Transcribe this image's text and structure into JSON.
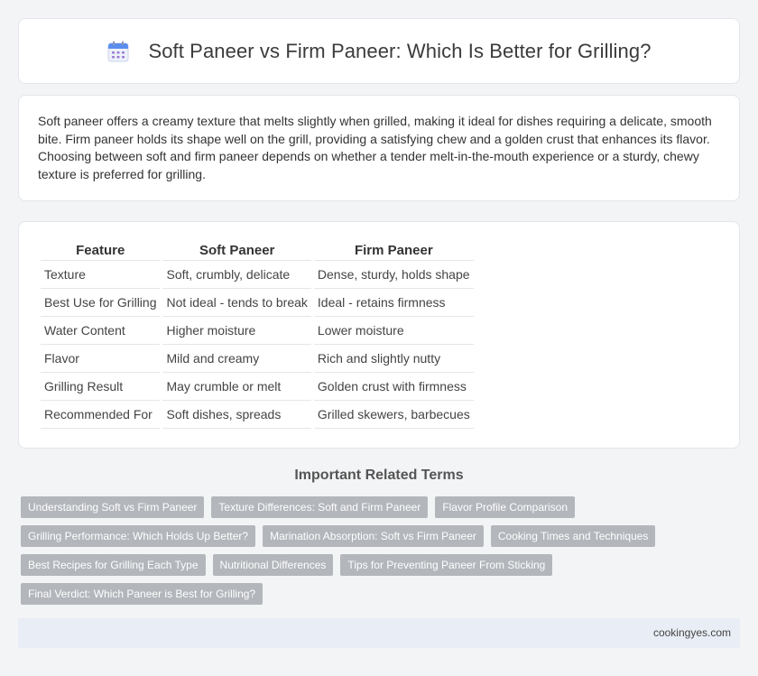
{
  "header": {
    "title": "Soft Paneer vs Firm Paneer: Which Is Better for Grilling?",
    "icon": "calendar-icon"
  },
  "intro": {
    "text": "Soft paneer offers a creamy texture that melts slightly when grilled, making it ideal for dishes requiring a delicate, smooth bite. Firm paneer holds its shape well on the grill, providing a satisfying chew and a golden crust that enhances its flavor. Choosing between soft and firm paneer depends on whether a tender melt-in-the-mouth experience or a sturdy, chewy texture is preferred for grilling."
  },
  "comparison": {
    "headers": [
      "Feature",
      "Soft Paneer",
      "Firm Paneer"
    ],
    "rows": [
      [
        "Texture",
        "Soft, crumbly, delicate",
        "Dense, sturdy, holds shape"
      ],
      [
        "Best Use for Grilling",
        "Not ideal - tends to break",
        "Ideal - retains firmness"
      ],
      [
        "Water Content",
        "Higher moisture",
        "Lower moisture"
      ],
      [
        "Flavor",
        "Mild and creamy",
        "Rich and slightly nutty"
      ],
      [
        "Grilling Result",
        "May crumble or melt",
        "Golden crust with firmness"
      ],
      [
        "Recommended For",
        "Soft dishes, spreads",
        "Grilled skewers, barbecues"
      ]
    ]
  },
  "related": {
    "title": "Important Related Terms",
    "tags": [
      "Understanding Soft vs Firm Paneer",
      "Texture Differences: Soft and Firm Paneer",
      "Flavor Profile Comparison",
      "Grilling Performance: Which Holds Up Better?",
      "Marination Absorption: Soft vs Firm Paneer",
      "Cooking Times and Techniques",
      "Best Recipes for Grilling Each Type",
      "Nutritional Differences",
      "Tips for Preventing Paneer From Sticking",
      "Final Verdict: Which Paneer is Best for Grilling?"
    ]
  },
  "footer": {
    "site": "cookingyes.com"
  },
  "colors": {
    "background": "#f3f4f6",
    "tag": "#b3b6bb",
    "footer": "#e9edf5",
    "icon_accent": "#5b8def"
  }
}
